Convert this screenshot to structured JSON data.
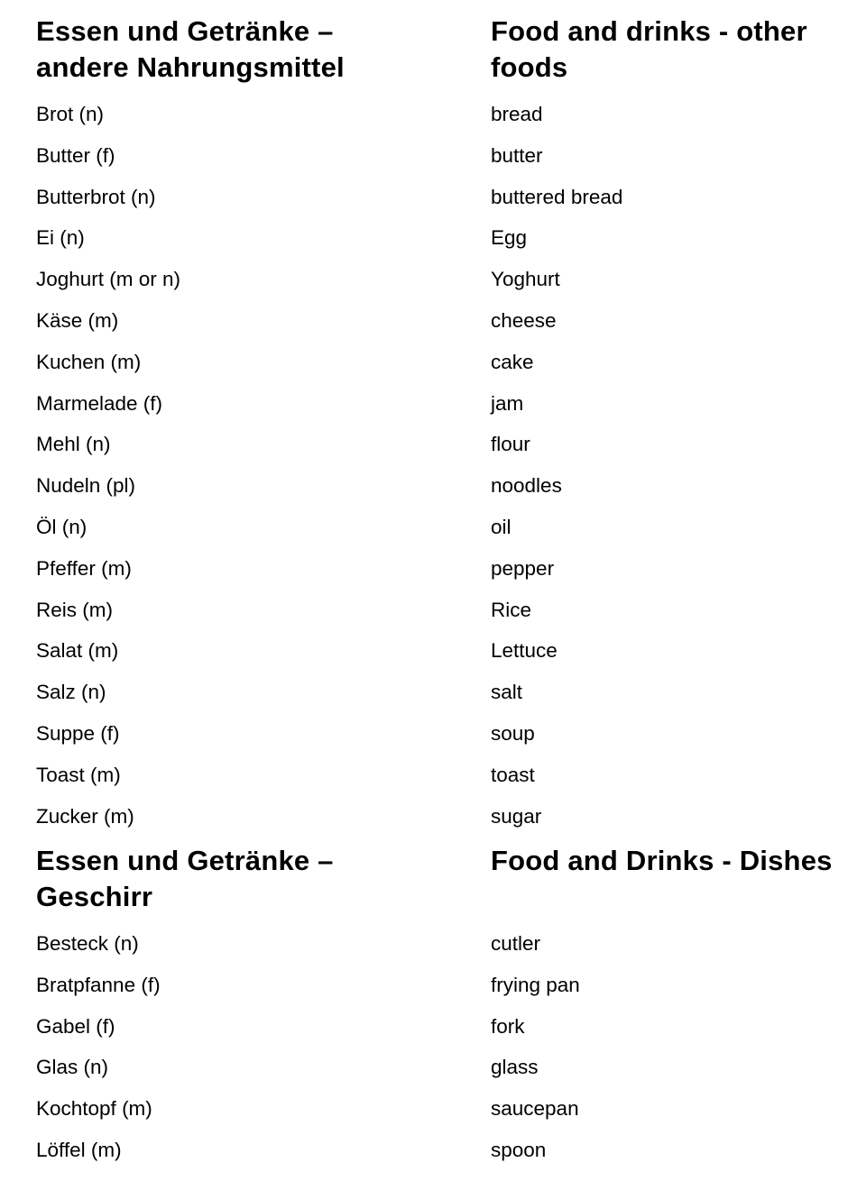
{
  "sections": [
    {
      "heading_de": "Essen und Getränke – andere Nahrungsmittel",
      "heading_en": "Food and drinks - other foods",
      "rows": [
        {
          "de": "Brot (n)",
          "en": "bread"
        },
        {
          "de": "Butter (f)",
          "en": "butter"
        },
        {
          "de": "Butterbrot (n)",
          "en": "buttered bread"
        },
        {
          "de": "Ei (n)",
          "en": "Egg"
        },
        {
          "de": "Joghurt (m or n)",
          "en": "Yoghurt"
        },
        {
          "de": "Käse (m)",
          "en": "cheese"
        },
        {
          "de": "Kuchen (m)",
          "en": "cake"
        },
        {
          "de": "Marmelade (f)",
          "en": "jam"
        },
        {
          "de": "Mehl (n)",
          "en": "flour"
        },
        {
          "de": "Nudeln (pl)",
          "en": "noodles"
        },
        {
          "de": "Öl (n)",
          "en": "oil"
        },
        {
          "de": "Pfeffer (m)",
          "en": "pepper"
        },
        {
          "de": "Reis (m)",
          "en": "Rice"
        },
        {
          "de": "Salat (m)",
          "en": "Lettuce"
        },
        {
          "de": "Salz (n)",
          "en": "salt"
        },
        {
          "de": "Suppe (f)",
          "en": "soup"
        },
        {
          "de": "Toast (m)",
          "en": "toast"
        },
        {
          "de": "Zucker (m)",
          "en": "sugar"
        }
      ]
    },
    {
      "heading_de": "Essen und Getränke – Geschirr",
      "heading_en": "Food and Drinks - Dishes",
      "rows": [
        {
          "de": "Besteck (n)",
          "en": "cutler"
        },
        {
          "de": "Bratpfanne (f)",
          "en": "frying pan"
        },
        {
          "de": "Gabel (f)",
          "en": "fork"
        },
        {
          "de": "Glas (n)",
          "en": "glass"
        },
        {
          "de": "Kochtopf (m)",
          "en": "saucepan"
        },
        {
          "de": "Löffel (m)",
          "en": "spoon"
        }
      ]
    }
  ]
}
